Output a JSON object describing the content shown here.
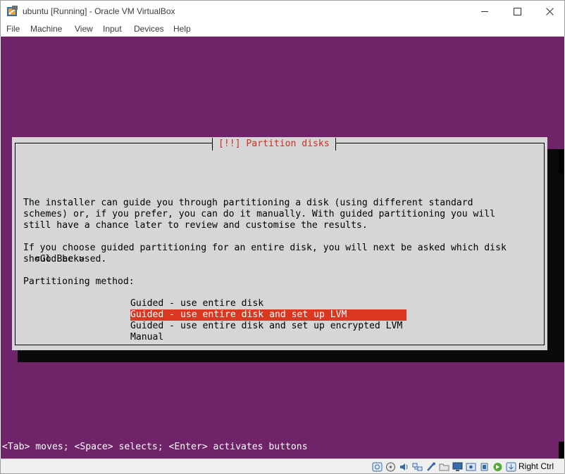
{
  "window": {
    "title": "ubuntu [Running] - Oracle VM VirtualBox"
  },
  "menubar": {
    "items": [
      "File",
      "Machine",
      "View",
      "Input",
      "Devices",
      "Help"
    ]
  },
  "installer": {
    "dialog_title": "[!!] Partition disks",
    "paragraph1": [
      "The installer can guide you through partitioning a disk (using different standard",
      "schemes) or, if you prefer, you can do it manually. With guided partitioning you will",
      "still have a chance later to review and customise the results."
    ],
    "paragraph2": [
      "If you choose guided partitioning for an entire disk, you will next be asked which disk",
      "should be used."
    ],
    "method_label": "Partitioning method:",
    "options": [
      "Guided - use entire disk",
      "Guided - use entire disk and set up LVM",
      "Guided - use entire disk and set up encrypted LVM",
      "Manual"
    ],
    "selected_option_index": 1,
    "go_back": "<Go Back>",
    "help_line": "<Tab> moves; <Space> selects; <Enter> activates buttons"
  },
  "statusbar": {
    "host_key": "Right Ctrl",
    "icons": [
      "hard-disk-icon",
      "optical-drive-icon",
      "audio-icon",
      "network-icon",
      "usb-icon",
      "shared-folders-icon",
      "display-icon",
      "video-capture-icon",
      "cpu-icon",
      "mouse-integration-icon",
      "keyboard-icon"
    ]
  },
  "colors": {
    "vm_background": "#6f2469",
    "dialog_background": "#d6d6d6",
    "dialog_title": "#cf2e20",
    "selection": "#db3822"
  }
}
